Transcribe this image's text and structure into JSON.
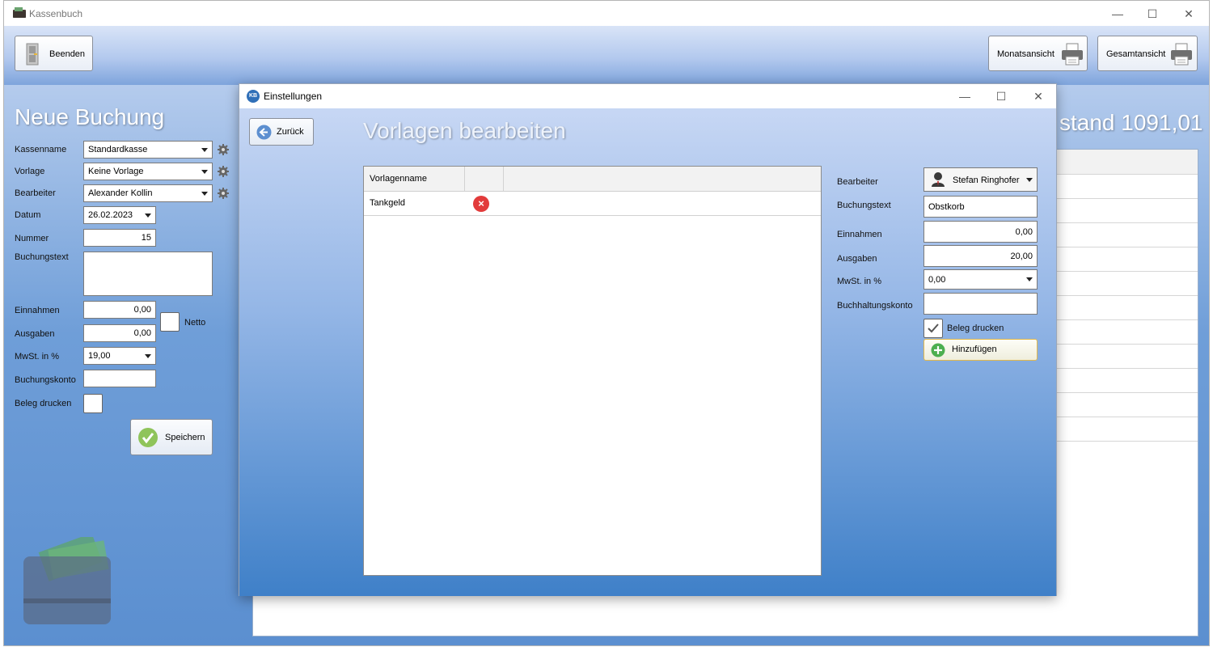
{
  "main_window": {
    "title": "Kassenbuch",
    "controls": {
      "minimize": "—",
      "maximize": "☐",
      "close": "✕"
    },
    "toolbar": {
      "quit_label": "Beenden",
      "month_view_label": "Monatsansicht",
      "total_view_label": "Gesamtansicht"
    },
    "new_booking": {
      "title": "Neue Buchung",
      "fields": {
        "cashbox_label": "Kassenname",
        "cashbox_value": "Standardkasse",
        "template_label": "Vorlage",
        "template_value": "Keine Vorlage",
        "editor_label": "Bearbeiter",
        "editor_value": "Alexander Kollin",
        "date_label": "Datum",
        "date_value": "26.02.2023",
        "number_label": "Nummer",
        "number_value": "15",
        "text_label": "Buchungstext",
        "text_value": "",
        "income_label": "Einnahmen",
        "income_value": "0,00",
        "net_label": "Netto",
        "expense_label": "Ausgaben",
        "expense_value": "0,00",
        "vat_label": "MwSt. in %",
        "vat_value": "19,00",
        "account_label": "Buchungskonto",
        "account_value": "",
        "print_label": "Beleg drucken"
      },
      "save_label": "Speichern"
    },
    "balance_text": "stand 1091,01"
  },
  "dialog": {
    "title": "Einstellungen",
    "icon_text": "KB",
    "back_label": "Zurück",
    "heading": "Vorlagen bearbeiten",
    "table": {
      "columns": [
        "Vorlagenname",
        "",
        ""
      ],
      "rows": [
        {
          "name": "Tankgeld"
        }
      ]
    },
    "form": {
      "editor_label": "Bearbeiter",
      "editor_value": "Stefan Ringhofer",
      "text_label": "Buchungstext",
      "text_value": "Obstkorb",
      "income_label": "Einnahmen",
      "income_value": "0,00",
      "expense_label": "Ausgaben",
      "expense_value": "20,00",
      "vat_label": "MwSt. in %",
      "vat_value": "0,00",
      "account_label": "Buchhaltungskonto",
      "account_value": "",
      "print_label": "Beleg drucken",
      "print_checked": true,
      "add_label": "Hinzufügen"
    }
  },
  "colors": {
    "accent_blue": "#5b8fd0",
    "delete_red": "#e23b3b",
    "add_green": "#4caf50",
    "add_button_border": "#e2b84a"
  }
}
